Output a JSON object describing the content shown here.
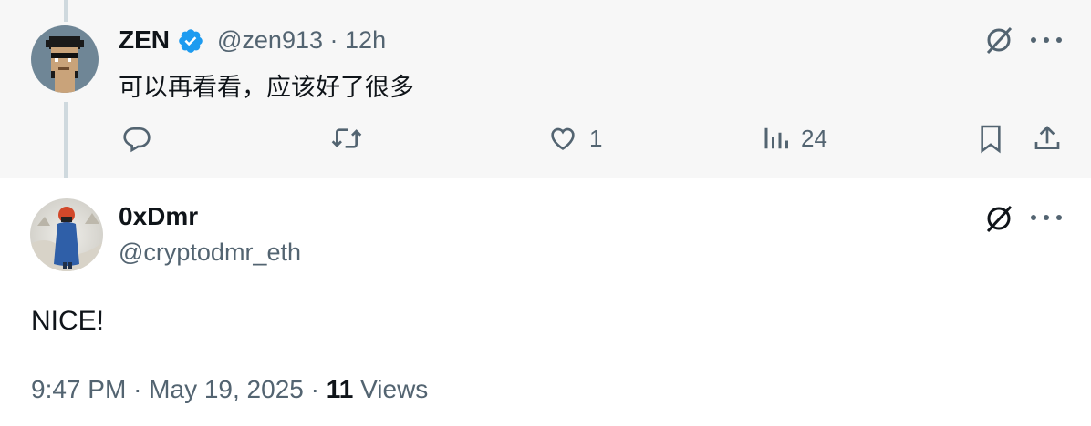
{
  "parent": {
    "name": "ZEN",
    "handle": "@zen913",
    "separator": "·",
    "time": "12h",
    "text": "可以再看看，应该好了很多",
    "actions": {
      "reply_count": "",
      "repost_count": "",
      "like_count": "1",
      "views_count": "24"
    }
  },
  "reply": {
    "name": "0xDmr",
    "handle": "@cryptodmr_eth",
    "text": "NICE!",
    "timestamp": "9:47 PM",
    "separator1": "·",
    "date": "May 19, 2025",
    "separator2": "·",
    "views_count": "11",
    "views_label": "Views"
  },
  "icons": {
    "verified": "verified-badge-icon",
    "grok": "grok-icon",
    "more": "more-icon",
    "reply": "reply-icon",
    "repost": "repost-icon",
    "like": "like-icon",
    "views": "views-icon",
    "bookmark": "bookmark-icon",
    "share": "share-icon"
  },
  "colors": {
    "verified_blue": "#1d9bf0",
    "muted_text": "#536471",
    "parent_background": "#f7f7f7"
  }
}
